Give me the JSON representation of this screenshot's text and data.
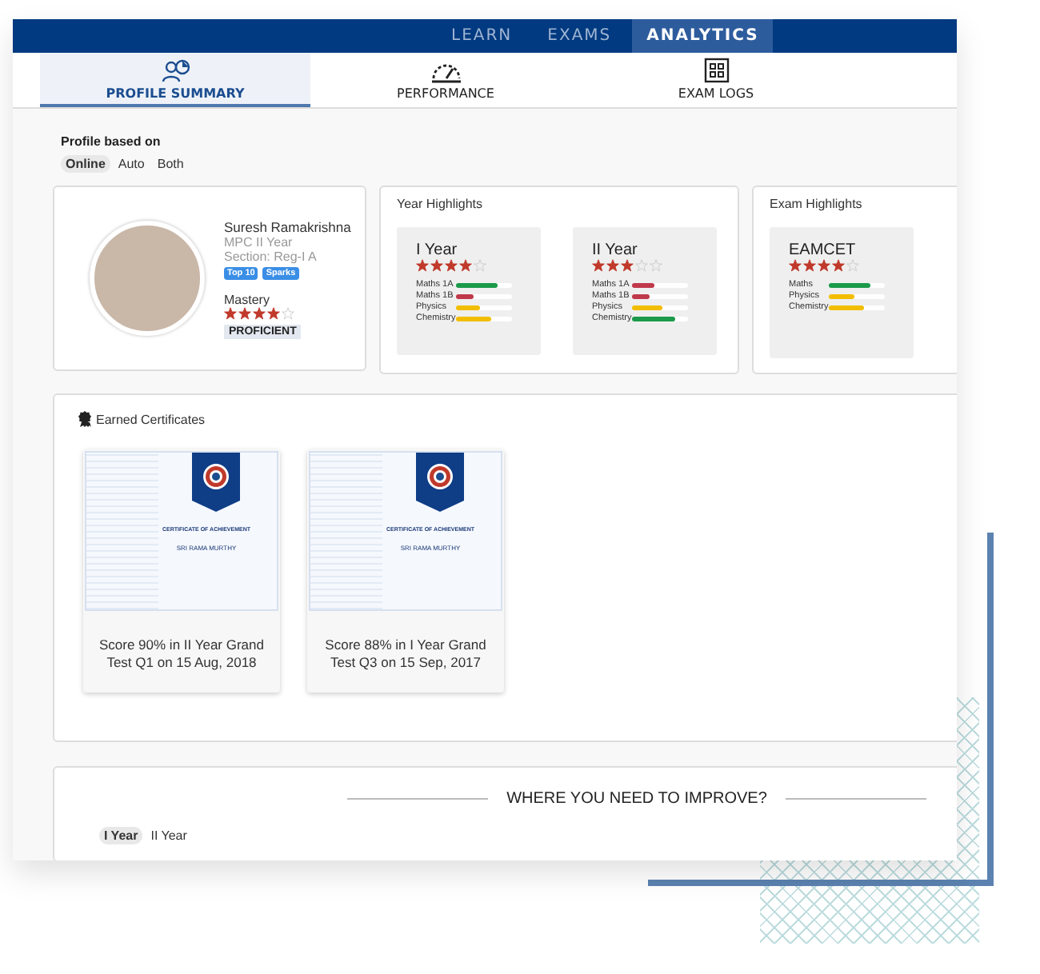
{
  "nav_tabs": [
    {
      "label": "LEARN",
      "selected": false
    },
    {
      "label": "EXAMS",
      "selected": false
    },
    {
      "label": "ANALYTICS",
      "selected": true
    }
  ],
  "sub_tabs": [
    {
      "label": "PROFILE SUMMARY",
      "kind": "profile",
      "selected": true
    },
    {
      "label": "PERFORMANCE",
      "kind": "gauge",
      "selected": false
    },
    {
      "label": "EXAM LOGS",
      "kind": "logs",
      "selected": false
    }
  ],
  "profile_basis": {
    "label": "Profile based on",
    "options": [
      {
        "label": "Online",
        "selected": true
      },
      {
        "label": "Auto",
        "selected": false
      },
      {
        "label": "Both",
        "selected": false
      }
    ]
  },
  "profile": {
    "name": "Suresh Ramakrishna",
    "course": "MPC II Year",
    "section": "Section: Reg-I A",
    "badges": [
      "Top 10",
      "Sparks"
    ],
    "mastery_label": "Mastery",
    "stars": 4,
    "level_label": "PROFICIENT"
  },
  "year_highlights": {
    "title": "Year Highlights",
    "cards": [
      {
        "title": "I Year",
        "stars": 4,
        "subjects": [
          {
            "name": "Maths 1A",
            "level": 0.75,
            "color": "#1a9a4a"
          },
          {
            "name": "Maths 1B",
            "level": 0.3,
            "color": "#c0394b"
          },
          {
            "name": "Physics",
            "level": 0.43,
            "color": "#f2bd00"
          },
          {
            "name": "Chemistry",
            "level": 0.62,
            "color": "#f2bd00"
          }
        ]
      },
      {
        "title": "II Year",
        "stars": 3,
        "subjects": [
          {
            "name": "Maths 1A",
            "level": 0.4,
            "color": "#c0394b"
          },
          {
            "name": "Maths 1B",
            "level": 0.3,
            "color": "#c0394b"
          },
          {
            "name": "Physics",
            "level": 0.55,
            "color": "#f2bd00"
          },
          {
            "name": "Chemistry",
            "level": 0.78,
            "color": "#1a9a4a"
          }
        ]
      }
    ]
  },
  "exam_highlights": {
    "title": "Exam Highlights",
    "cards": [
      {
        "title": "EAMCET",
        "stars": 4,
        "subjects": [
          {
            "name": "Maths",
            "level": 0.75,
            "color": "#1a9a4a"
          },
          {
            "name": "Physics",
            "level": 0.45,
            "color": "#f2bd00"
          },
          {
            "name": "Chemistry",
            "level": 0.62,
            "color": "#f2bd00"
          }
        ]
      }
    ]
  },
  "certificates": {
    "title": "Earned Certificates",
    "items": [
      {
        "heading": "CERTIFICATE OF ACHIEVEMENT",
        "recipient": "SRI RAMA MURTHY",
        "caption": "Score 90% in II Year Grand Test Q1 on 15 Aug, 2018"
      },
      {
        "heading": "CERTIFICATE OF ACHIEVEMENT",
        "recipient": "SRI RAMA MURTHY",
        "caption": "Score 88% in I Year Grand Test Q3 on 15 Sep, 2017"
      }
    ]
  },
  "improve": {
    "title": "WHERE YOU NEED TO IMPROVE?",
    "options": [
      {
        "label": "I Year",
        "selected": true
      },
      {
        "label": "II Year",
        "selected": false
      }
    ]
  }
}
